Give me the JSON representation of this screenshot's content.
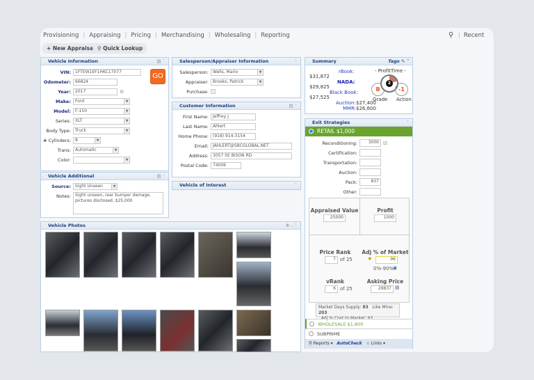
{
  "nav": {
    "items": [
      "Provisioning",
      "Appraising",
      "Pricing",
      "Merchandising",
      "Wholesaling",
      "Reporting"
    ],
    "recent": "Recent"
  },
  "toolbar": {
    "new_appraisal": "New Appraisal",
    "quick_lookup": "Quick Lookup"
  },
  "vehicle_info": {
    "title": "Vehicle Information",
    "go": "GO",
    "fields": [
      {
        "label": "VIN:",
        "value": "1FTEW1EF1HKC17077"
      },
      {
        "label": "Odometer:",
        "value": "66824"
      },
      {
        "label": "Year:",
        "value": "2017"
      },
      {
        "label": "Make:",
        "value": "Ford"
      },
      {
        "label": "Model:",
        "value": "F-150"
      },
      {
        "label": "Series:",
        "value": "XLT"
      },
      {
        "label": "Body Type:",
        "value": "Truck"
      },
      {
        "label": "# Cylinders:",
        "value": "8"
      },
      {
        "label": "Trans:",
        "value": "Automatic"
      },
      {
        "label": "Color:",
        "value": ""
      }
    ]
  },
  "vehicle_additional": {
    "title": "Vehicle Additional",
    "source_label": "Source:",
    "source": "Sight Unseen",
    "notes_label": "Notes:",
    "notes": "Sight unseen, rear bumper damage, pictures disclosed, $25,000"
  },
  "salesperson": {
    "title": "Salesperson/Appraiser Information",
    "salesperson_label": "Salesperson:",
    "salesperson": "Wells, Mario",
    "appraiser_label": "Appraiser:",
    "appraiser": "Brooks, Patrick",
    "purchase_label": "Purchase:"
  },
  "customer": {
    "title": "Customer Information",
    "fields": [
      {
        "label": "First Name:",
        "value": "Jeffrey J"
      },
      {
        "label": "Last Name:",
        "value": "Ahlert"
      },
      {
        "label": "Home Phone:",
        "value": "(918) 914-3154"
      },
      {
        "label": "Email:",
        "value": "JAHLERT@SBCGLOBAL.NET"
      },
      {
        "label": "Address:",
        "value": "3057 SE BISON RD"
      },
      {
        "label": "Postal Code:",
        "value": "74006"
      }
    ]
  },
  "vehicle_interest": {
    "title": "Vehicle of Interest"
  },
  "photos": {
    "title": "Vehicle Photos"
  },
  "summary": {
    "title": "Summary",
    "tags": "Tags",
    "rbook_label": "rBook:",
    "rbook": "$31,872",
    "nada_label": "NADA:",
    "nada": "$29,825",
    "bb_label": "Black Book:",
    "bb": "$27,525",
    "auction_label": "Auction:",
    "auction": "$27,400",
    "mmr_label": "MMR:",
    "mmr": "$26,600",
    "profittime": "- ProfitTime -",
    "gauge": "2",
    "grade": "B",
    "grade_label": "Grade",
    "action": "-1",
    "action_label": "Action"
  },
  "exit": {
    "title": "Exit Strategies",
    "retail": "RETAIL  $1,000",
    "costs": [
      {
        "label": "Reconditioning:",
        "value": "3000"
      },
      {
        "label": "Certification:",
        "value": ""
      },
      {
        "label": "Transportation:",
        "value": ""
      },
      {
        "label": "Auction:",
        "value": ""
      },
      {
        "label": "Pack:",
        "value": "837"
      },
      {
        "label": "Other:",
        "value": ""
      }
    ],
    "appraised_label": "Appraised Value",
    "appraised": "25000",
    "profit_label": "Profit",
    "profit": "1000",
    "price_rank_label": "Price Rank",
    "price_rank": "7",
    "of": "of 25",
    "adj_label": "Adj % of Market",
    "adj": "96",
    "range": "0%-90%",
    "vrank_label": "vRank",
    "vrank": "6",
    "asking_label": "Asking Price",
    "asking": "29837",
    "mds_label": "Market Days Supply:",
    "mds": "83",
    "like_label": "Like Mine:",
    "like": "203",
    "adjcost_label": "Adj % Cost to Market:",
    "adjcost": "93",
    "wholesale": "WHOLESALE  $1,800",
    "subprime": "SUBPRIME",
    "reports": "Reports",
    "autocheck": "AutoCheck",
    "links": "Links"
  },
  "colors": {
    "accent": "#6aa42f",
    "go": "#f26a22",
    "header": "#1d3f7a"
  }
}
